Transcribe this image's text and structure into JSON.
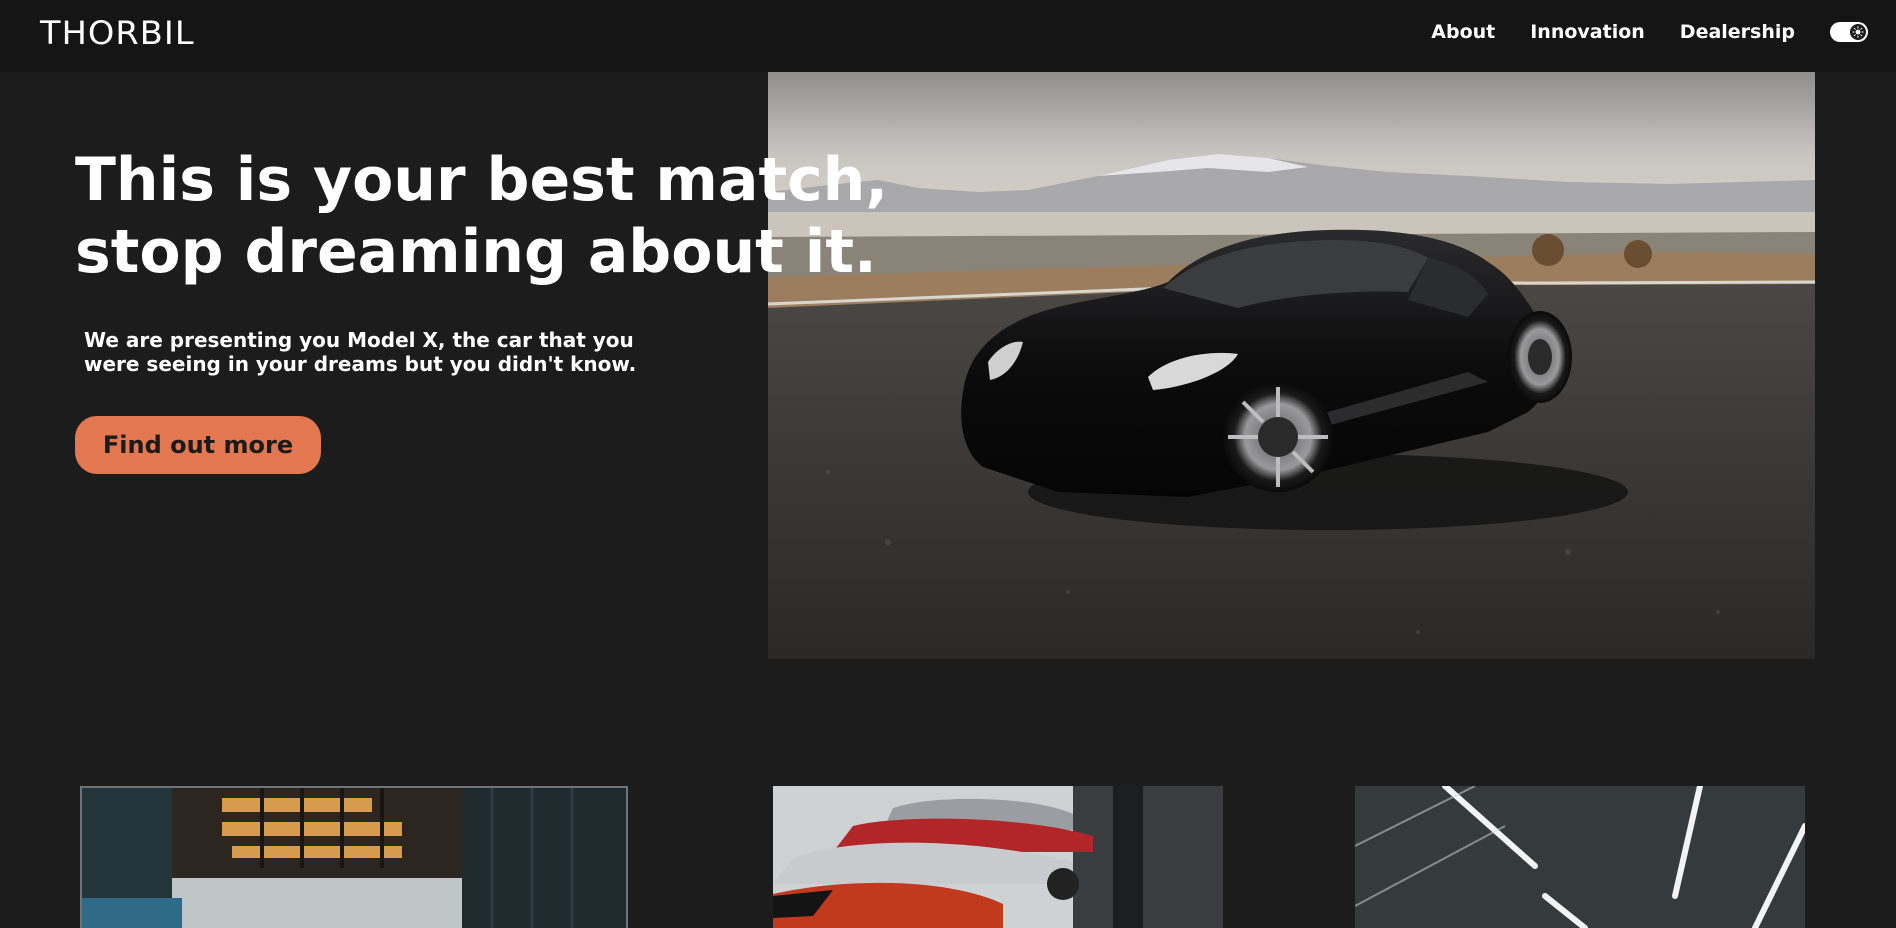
{
  "brand": {
    "logo_text": "THORBIL"
  },
  "nav": {
    "links": [
      "About",
      "Innovation",
      "Dealership"
    ],
    "theme_toggle_icon": "sun-icon"
  },
  "hero": {
    "headline_line1": "This is your best match,",
    "headline_line2": "stop dreaming about it.",
    "subtext_line1": "We are presenting you Model X, the car that you",
    "subtext_line2": "were seeing in your dreams but you didn't know.",
    "cta_label": "Find out more",
    "image_subject": "black sports car on asphalt with snowy mountains"
  },
  "cards": [
    {
      "image_subject": "modern glass building at dusk"
    },
    {
      "image_subject": "row of sports cars in showroom"
    },
    {
      "image_subject": "tunnel ceiling with light strips"
    }
  ],
  "colors": {
    "background": "#1c1c1c",
    "navbar": "#151515",
    "accent": "#e3774f",
    "text": "#ffffff"
  }
}
